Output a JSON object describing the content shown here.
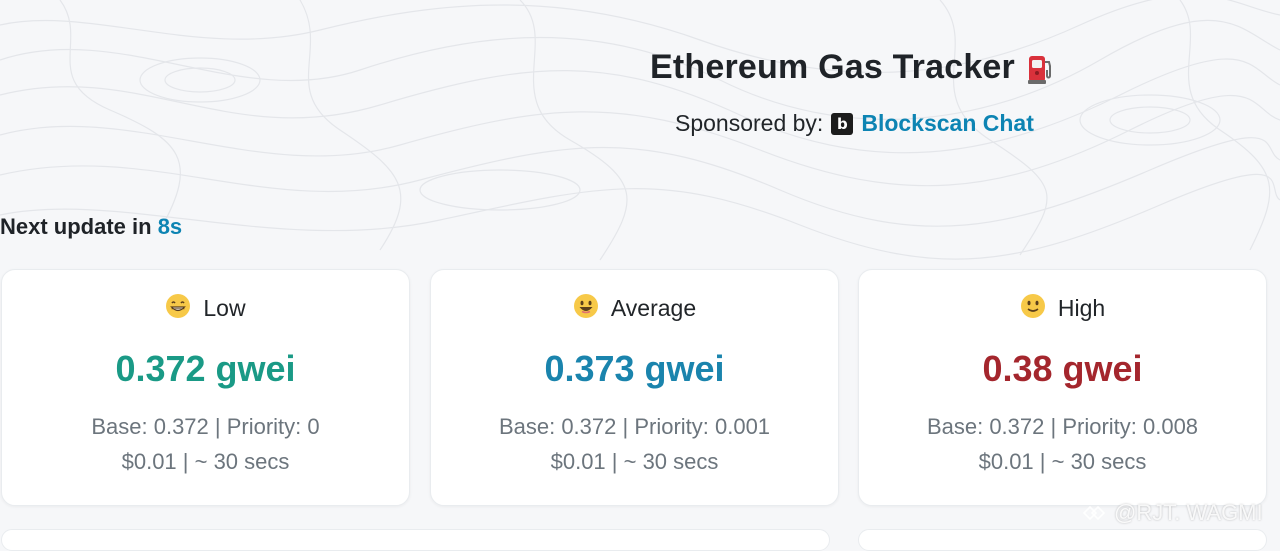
{
  "header": {
    "title": "Ethereum Gas Tracker",
    "sponsor_label": "Sponsored by:",
    "sponsor_logo_letter": "b",
    "sponsor_link": "Blockscan Chat"
  },
  "update": {
    "prefix": "Next update in ",
    "seconds": "8s"
  },
  "cards": [
    {
      "label": "Low",
      "emoji": "grinning-face-icon",
      "gwei": "0.372 gwei",
      "detail": "Base: 0.372 | Priority: 0",
      "cost": "$0.01 | ~ 30 secs",
      "color": "#1a9a86"
    },
    {
      "label": "Average",
      "emoji": "smiling-face-icon",
      "gwei": "0.373 gwei",
      "detail": "Base: 0.372 | Priority: 0.001",
      "cost": "$0.01 | ~ 30 secs",
      "color": "#1a84ad"
    },
    {
      "label": "High",
      "emoji": "slightly-smiling-face-icon",
      "gwei": "0.38 gwei",
      "detail": "Base: 0.372 | Priority: 0.008",
      "cost": "$0.01 | ~ 30 secs",
      "color": "#a4262d"
    }
  ],
  "watermark": {
    "text": "@RJT. WAGMI"
  },
  "colors": {
    "accent": "#0d84b3",
    "low": "#1a9a86",
    "average": "#1a84ad",
    "high": "#a4262d"
  }
}
